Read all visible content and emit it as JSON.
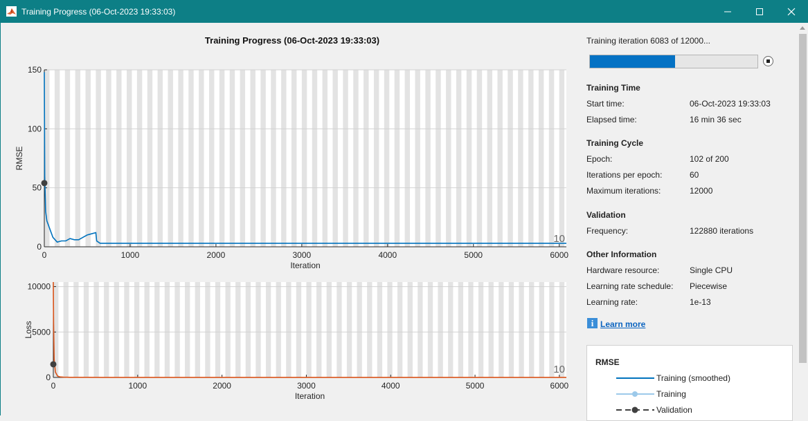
{
  "window": {
    "title": "Training Progress (06-Oct-2023 19:33:03)"
  },
  "plot_title": "Training Progress (06-Oct-2023 19:33:03)",
  "status": {
    "iteration_text": "Training iteration 6083 of 12000...",
    "progress": 0.507
  },
  "sections": {
    "training_time": {
      "heading": "Training Time",
      "rows": [
        {
          "label": "Start time:",
          "value": "06-Oct-2023 19:33:03"
        },
        {
          "label": "Elapsed time:",
          "value": "16 min 36 sec"
        }
      ]
    },
    "training_cycle": {
      "heading": "Training Cycle",
      "rows": [
        {
          "label": "Epoch:",
          "value": "102 of 200"
        },
        {
          "label": "Iterations per epoch:",
          "value": "60"
        },
        {
          "label": "Maximum iterations:",
          "value": "12000"
        }
      ]
    },
    "validation": {
      "heading": "Validation",
      "rows": [
        {
          "label": "Frequency:",
          "value": "122880 iterations"
        }
      ]
    },
    "other_information": {
      "heading": "Other Information",
      "rows": [
        {
          "label": "Hardware resource:",
          "value": "Single CPU"
        },
        {
          "label": "Learning rate schedule:",
          "value": "Piecewise"
        },
        {
          "label": "Learning rate:",
          "value": "1e-13"
        }
      ]
    }
  },
  "learn_more": "Learn more",
  "legend": {
    "title": "RMSE",
    "items": [
      {
        "label": "Training (smoothed)",
        "color": "#0072bd"
      },
      {
        "label": "Training",
        "color": "#9cc9ea"
      },
      {
        "label": "Validation",
        "color": "#404040"
      }
    ]
  },
  "colors": {
    "titlebar": "#0d7f86",
    "rmse_line": "#0072bd",
    "loss_line": "#d95319",
    "progress": "#0572c4"
  },
  "icons": [
    "matlab-icon",
    "minimize-icon",
    "maximize-icon",
    "close-icon",
    "stop-icon",
    "info-icon"
  ],
  "chart_data": [
    {
      "type": "line",
      "ylabel": "RMSE",
      "xlabel": "Iteration",
      "xlim": [
        0,
        6083
      ],
      "ylim": [
        0,
        150
      ],
      "xticks": [
        0,
        1000,
        2000,
        3000,
        4000,
        5000,
        6000
      ],
      "yticks": [
        0,
        50,
        100,
        150
      ],
      "epoch_label": "10",
      "series": [
        {
          "x": [
            0,
            5,
            15,
            30,
            60,
            100,
            150,
            200,
            250,
            300,
            350,
            400,
            450,
            500,
            550,
            600,
            610,
            650,
            1000,
            2000,
            3000,
            4000,
            5000,
            6000,
            6083
          ],
          "y": [
            148,
            60,
            30,
            22,
            16,
            8,
            4,
            5,
            5,
            7,
            6,
            6,
            8,
            10,
            11,
            12,
            5,
            3,
            3,
            3,
            3,
            3,
            3,
            3,
            3
          ]
        }
      ],
      "validation": [
        {
          "x": 0,
          "y": 54
        }
      ]
    },
    {
      "type": "line",
      "ylabel": "Loss",
      "xlabel": "Iteration",
      "xlim": [
        0,
        6083
      ],
      "ylim": [
        0,
        10500
      ],
      "xticks": [
        0,
        1000,
        2000,
        3000,
        4000,
        5000,
        6000
      ],
      "yticks": [
        0,
        5000,
        10000
      ],
      "epoch_label": "10",
      "series": [
        {
          "x": [
            0,
            3,
            10,
            25,
            50,
            80,
            120,
            200,
            600,
            1000,
            3000,
            6083
          ],
          "y": [
            10500,
            6000,
            2000,
            600,
            150,
            60,
            30,
            15,
            10,
            8,
            6,
            5
          ]
        }
      ],
      "validation": [
        {
          "x": 0,
          "y": 1450
        }
      ]
    }
  ]
}
